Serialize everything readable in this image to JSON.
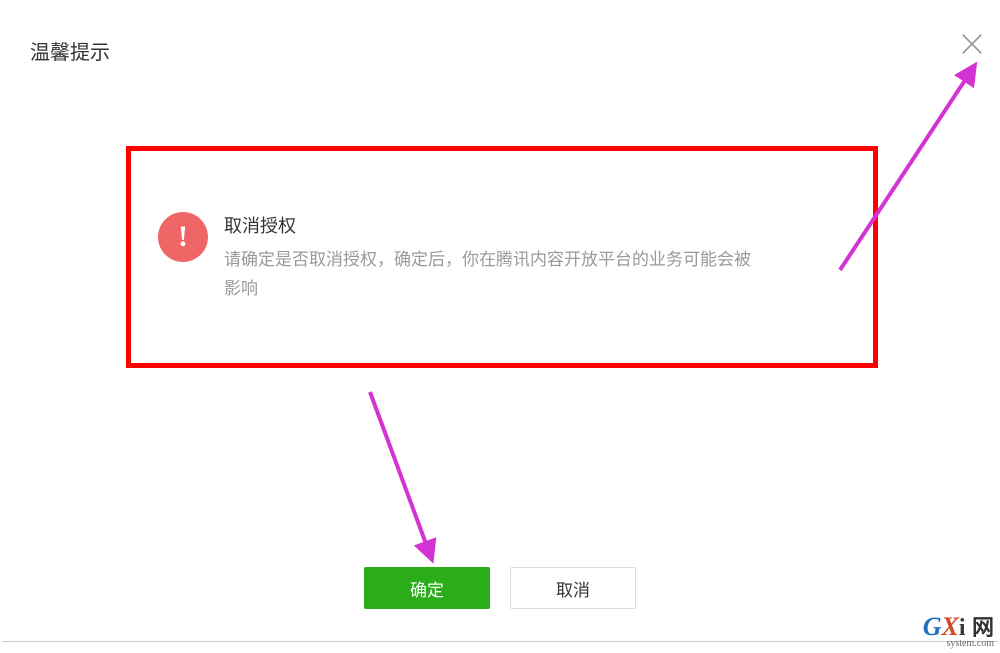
{
  "dialog": {
    "title": "温馨提示",
    "warning_heading": "取消授权",
    "warning_message": "请确定是否取消授权，确定后，你在腾讯内容开放平台的业务可能会被影响",
    "confirm_label": "确定",
    "cancel_label": "取消"
  },
  "watermark": {
    "g": "G",
    "x": "X",
    "i": "i",
    "net": "网",
    "sub": "system.com"
  },
  "colors": {
    "primary": "#2aad19",
    "warning_icon": "#f06565",
    "annotation_red": "#ff0000",
    "annotation_arrow": "#d433d4"
  }
}
